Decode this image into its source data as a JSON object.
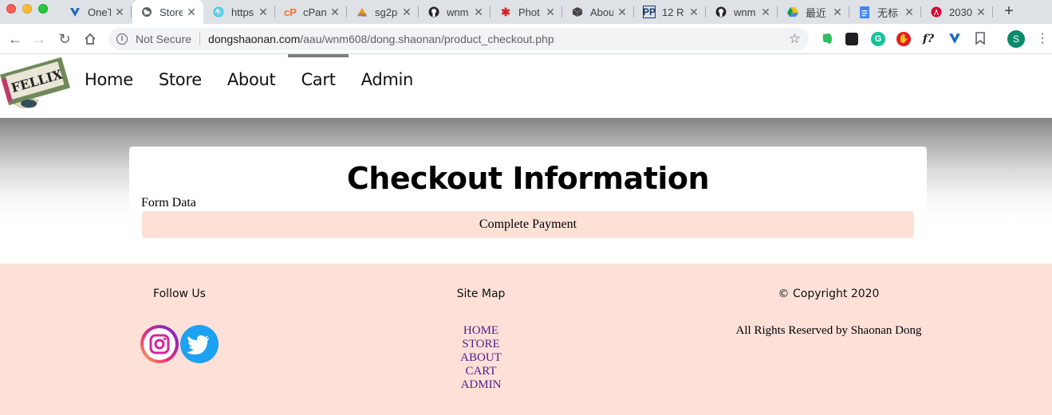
{
  "browser": {
    "tabs": [
      {
        "title": "OneT",
        "icon": "vuetify-icon",
        "active": false
      },
      {
        "title": "Store",
        "icon": "globe-icon",
        "active": true
      },
      {
        "title": "https",
        "icon": "codepen-swirl-icon",
        "active": false
      },
      {
        "title": "cPan",
        "icon": "cpanel-icon",
        "active": false
      },
      {
        "title": "sg2p",
        "icon": "phpmyadmin-icon",
        "active": false
      },
      {
        "title": "wnm",
        "icon": "github-icon",
        "active": false
      },
      {
        "title": "Phot",
        "icon": "yelp-icon",
        "active": false
      },
      {
        "title": "Abou",
        "icon": "cube-icon",
        "active": false
      },
      {
        "title": "12 R",
        "icon": "pp-icon",
        "active": false
      },
      {
        "title": "wnm",
        "icon": "github-icon",
        "active": false
      },
      {
        "title": "最近",
        "icon": "drive-icon",
        "active": false
      },
      {
        "title": "无标",
        "icon": "docs-icon",
        "active": false
      },
      {
        "title": "2030",
        "icon": "angular-icon",
        "active": false
      }
    ],
    "security_label": "Not Secure",
    "url_host": "dongshaonan.com",
    "url_path": "/aau/wnm608/dong.shaonan/product_checkout.php",
    "profile_initial": "S",
    "extension_f_label": "f?"
  },
  "site": {
    "logo_text": "FELLIX",
    "nav": [
      {
        "label": "Home",
        "active": false
      },
      {
        "label": "Store",
        "active": false
      },
      {
        "label": "About",
        "active": false
      },
      {
        "label": "Cart",
        "active": true
      },
      {
        "label": "Admin",
        "active": false
      }
    ]
  },
  "checkout": {
    "title": "Checkout Information",
    "form_data_label": "Form Data",
    "pay_button_label": "Complete Payment"
  },
  "footer": {
    "follow_heading": "Follow Us",
    "sitemap_heading": "Site Map",
    "copyright": "© Copyright 2020",
    "sitemap_links": [
      "HOME",
      "STORE",
      "ABOUT",
      "CART",
      "ADMIN"
    ],
    "rights": "All Rights Reserved by Shaonan Dong",
    "social": [
      "instagram-icon",
      "twitter-icon"
    ]
  },
  "colors": {
    "footer_bg": "#fde1d8",
    "pay_button_bg": "#fde1d7",
    "link_visited": "#551a8b",
    "nav_active_bar": "#7d7d7d"
  }
}
